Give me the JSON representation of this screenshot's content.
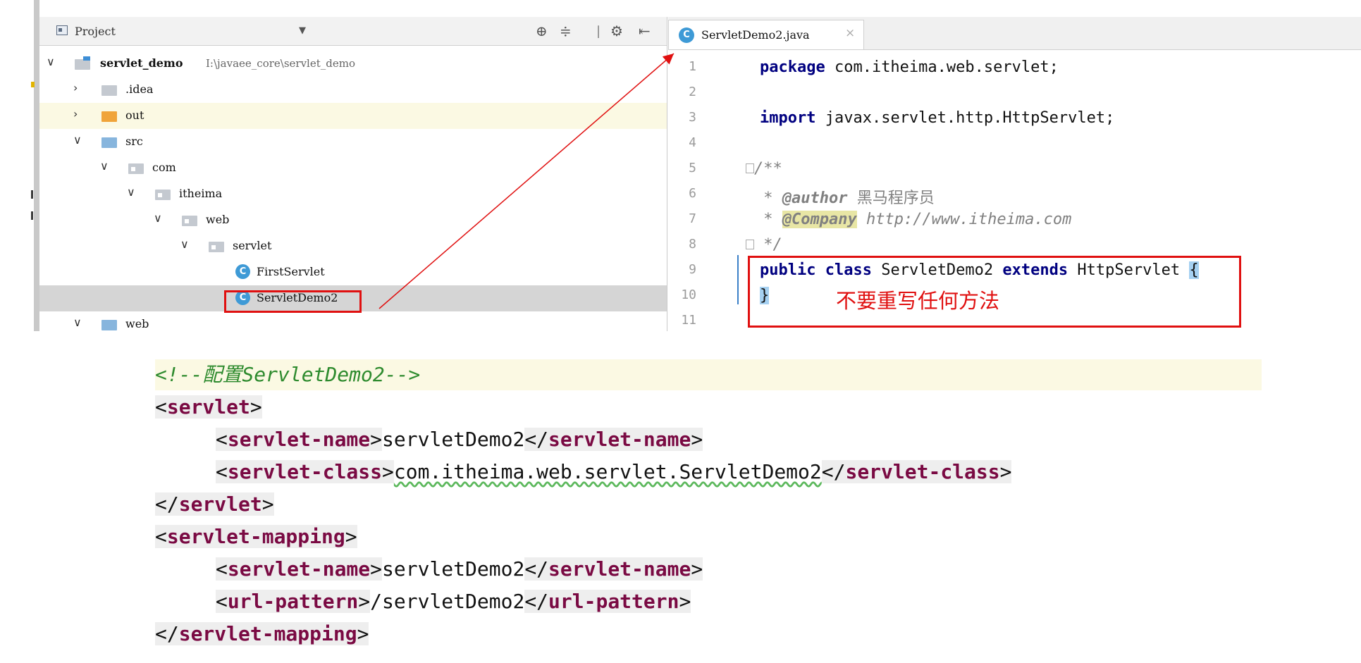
{
  "project_panel": {
    "title": "Project",
    "tree": [
      {
        "label": "servlet_demo",
        "path": "I:\\javaee_core\\servlet_demo"
      },
      {
        "label": ".idea"
      },
      {
        "label": "out"
      },
      {
        "label": "src"
      },
      {
        "label": "com"
      },
      {
        "label": "itheima"
      },
      {
        "label": "web"
      },
      {
        "label": "servlet"
      },
      {
        "label": "FirstServlet"
      },
      {
        "label": "ServletDemo2"
      },
      {
        "label": "web"
      }
    ],
    "class_icon_letter": "C"
  },
  "editor": {
    "tab": {
      "name": "ServletDemo2.java",
      "icon_letter": "C",
      "close": "×"
    },
    "lines": [
      {
        "num": "1",
        "kw": "package",
        "rest": " com.itheima.web.servlet;"
      },
      {
        "num": "2"
      },
      {
        "num": "3",
        "kw": "import",
        "rest": " javax.servlet.http.HttpServlet;"
      },
      {
        "num": "4"
      },
      {
        "num": "5",
        "comment": "/**"
      },
      {
        "num": "6",
        "star": " * ",
        "tag": "@author",
        "value": " 黑马程序员"
      },
      {
        "num": "7",
        "star": " * ",
        "tag": "@Company",
        "value": " http://www.itheima.com"
      },
      {
        "num": "8",
        "comment": " */"
      },
      {
        "num": "9",
        "kw1": "public",
        "kw2": "class",
        "name": "ServletDemo2",
        "kw3": "extends",
        "parent": "HttpServlet",
        "brace": "{"
      },
      {
        "num": "10",
        "brace": "}"
      },
      {
        "num": "11"
      }
    ],
    "note": "不要重写任何方法"
  },
  "xml": {
    "comment": "<!--配置ServletDemo2-->",
    "servlet_open": "servlet",
    "servlet_name_tag": "servlet-name",
    "servlet_name_value": "servletDemo2",
    "servlet_class_tag": "servlet-class",
    "servlet_class_value": "com.itheima.web.servlet.ServletDemo2",
    "servlet_close": "servlet",
    "mapping_open": "servlet-mapping",
    "mapping_name_tag": "servlet-name",
    "mapping_name_value": "servletDemo2",
    "url_tag": "url-pattern",
    "url_value": "/servletDemo2",
    "mapping_close": "servlet-mapping"
  },
  "colors": {
    "accent_red": "#e01010",
    "class_icon": "#3e9ad6",
    "xml_tag": "#7a0a43",
    "keyword": "#000080"
  }
}
